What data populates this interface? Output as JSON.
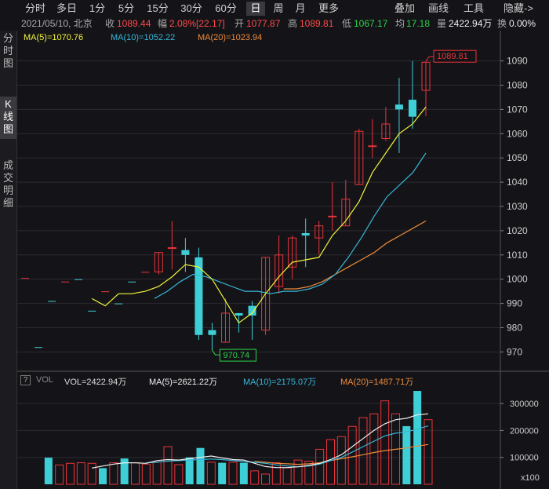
{
  "toolbar": {
    "period_tabs": [
      "分时",
      "多日",
      "1分",
      "5分",
      "15分",
      "30分",
      "60分",
      "日",
      "周",
      "月",
      "更多"
    ],
    "active_tab": "日",
    "right_tabs": [
      "叠加",
      "画线",
      "工具",
      "隐藏->"
    ]
  },
  "info": {
    "date": "2021/05/10, 北京",
    "close_label": "收",
    "close": "1089.44",
    "change_label": "幅",
    "change": "2.08%[22.17]",
    "open_label": "开",
    "open": "1077.87",
    "high_label": "高",
    "high": "1089.81",
    "low_label": "低",
    "low": "1067.17",
    "avg_label": "均",
    "avg": "17.18",
    "vol_label": "量",
    "vol": "2422.94万",
    "turnover_label": "换",
    "turnover": "0.00%"
  },
  "sidebar": [
    {
      "label": "分\n时\n图"
    },
    {
      "label": "K\n线\n图",
      "active": true
    },
    {
      "label": "成\n交\n明\n细"
    }
  ],
  "ma_legend": {
    "ma5": "MA(5)=1070.76",
    "ma10": "MA(10)=1052.22",
    "ma20": "MA(20)=1023.94"
  },
  "vol_legend": {
    "question": "?",
    "title": "VOL",
    "vol": "VOL=2422.94万",
    "ma5": "MA(5)=2621.22万",
    "ma10": "MA(10)=2175.07万",
    "ma20": "MA(20)=1487.71万"
  },
  "colors": {
    "up": "#e8333a",
    "down": "#3ecfd6",
    "ma5": "#f2f23a",
    "ma10": "#38b6d8",
    "ma20": "#ee8a3a",
    "grid": "#2a2a30"
  },
  "chart_data": [
    {
      "type": "candlestick",
      "y_ticks": [
        970,
        980,
        990,
        1000,
        1010,
        1020,
        1030,
        1040,
        1050,
        1060,
        1070,
        1080,
        1090
      ],
      "ylim": [
        963,
        1097
      ],
      "annotations": {
        "high": "1089.81",
        "low": "970.74"
      },
      "candles": [
        {
          "o": 1000.5,
          "h": 1000.5,
          "l": 1000.5,
          "c": 1000.5
        },
        {
          "o": 972,
          "h": 972,
          "l": 972,
          "c": 972
        },
        {
          "o": 991,
          "h": 991,
          "l": 991,
          "c": 991
        },
        {
          "o": 999,
          "h": 999,
          "l": 999,
          "c": 999
        },
        {
          "o": 1000,
          "h": 1000,
          "l": 1000,
          "c": 1000
        },
        {
          "o": 987,
          "h": 987,
          "l": 987,
          "c": 987
        },
        {
          "o": 995,
          "h": 995,
          "l": 995,
          "c": 995
        },
        {
          "o": 990,
          "h": 990,
          "l": 990,
          "c": 990
        },
        {
          "o": 999,
          "h": 999,
          "l": 999,
          "c": 999
        },
        {
          "o": 1003,
          "h": 1003,
          "l": 1003,
          "c": 1003
        },
        {
          "o": 1003,
          "h": 1011,
          "l": 1002,
          "c": 1011
        },
        {
          "o": 1013,
          "h": 1024,
          "l": 1004,
          "c": 1013
        },
        {
          "o": 1012,
          "h": 1017,
          "l": 1003,
          "c": 1010
        },
        {
          "o": 1009,
          "h": 1013,
          "l": 975,
          "c": 977
        },
        {
          "o": 979,
          "h": 982,
          "l": 970.74,
          "c": 977
        },
        {
          "o": 974,
          "h": 992,
          "l": 974,
          "c": 986
        },
        {
          "o": 986,
          "h": 986,
          "l": 978,
          "c": 985
        },
        {
          "o": 989,
          "h": 991,
          "l": 975,
          "c": 985
        },
        {
          "o": 979,
          "h": 1009,
          "l": 977,
          "c": 1009
        },
        {
          "o": 997,
          "h": 1018,
          "l": 994,
          "c": 1010
        },
        {
          "o": 1005,
          "h": 1018,
          "l": 1000,
          "c": 1017
        },
        {
          "o": 1019,
          "h": 1025,
          "l": 1005,
          "c": 1018
        },
        {
          "o": 1017,
          "h": 1024,
          "l": 1010,
          "c": 1022
        },
        {
          "o": 1026,
          "h": 1040,
          "l": 1020,
          "c": 1026
        },
        {
          "o": 1022,
          "h": 1041,
          "l": 1022,
          "c": 1033
        },
        {
          "o": 1039,
          "h": 1062,
          "l": 1039,
          "c": 1061
        },
        {
          "o": 1055,
          "h": 1066,
          "l": 1050,
          "c": 1055
        },
        {
          "o": 1058,
          "h": 1071,
          "l": 1057,
          "c": 1064
        },
        {
          "o": 1072,
          "h": 1083,
          "l": 1052,
          "c": 1070
        },
        {
          "o": 1074,
          "h": 1090,
          "l": 1062,
          "c": 1067
        },
        {
          "o": 1077.87,
          "h": 1089.81,
          "l": 1067.17,
          "c": 1089.44
        }
      ],
      "ma5": [
        null,
        null,
        null,
        null,
        null,
        992,
        989,
        994,
        994,
        995,
        997,
        1001,
        1006,
        1005,
        1000,
        991,
        982,
        986,
        994,
        1001,
        1007,
        1008,
        1009,
        1018,
        1024,
        1032,
        1044,
        1052,
        1060,
        1064,
        1071
      ],
      "ma10": [
        null,
        null,
        null,
        null,
        null,
        null,
        null,
        null,
        null,
        null,
        992,
        995,
        999,
        1002,
        1001,
        999,
        997,
        995,
        995,
        994,
        995,
        995,
        996,
        998,
        1002,
        1009,
        1017,
        1026,
        1034,
        1039,
        1044,
        1052
      ],
      "ma20": [
        null,
        null,
        null,
        null,
        null,
        null,
        null,
        null,
        null,
        null,
        null,
        null,
        null,
        null,
        null,
        null,
        null,
        null,
        null,
        null,
        996,
        996,
        997,
        999,
        1002,
        1005,
        1008,
        1011,
        1015,
        1018,
        1021,
        1024
      ]
    },
    {
      "type": "bar",
      "title": "VOL",
      "y_ticks": [
        100000,
        200000,
        300000
      ],
      "y_unit": "x100",
      "ylim": [
        0,
        350000
      ],
      "values": [
        0,
        99000,
        72000,
        78000,
        80000,
        78000,
        60000,
        80000,
        96000,
        80000,
        75000,
        83000,
        140000,
        73000,
        100000,
        135000,
        82000,
        80000,
        82000,
        80000,
        50000,
        38000,
        80000,
        61000,
        90000,
        86000,
        130000,
        166000,
        177000,
        215000,
        248000,
        262000,
        310000,
        262000,
        216000,
        347000,
        240000
      ],
      "directions": [
        "u",
        "d",
        "u",
        "u",
        "u",
        "u",
        "d",
        "u",
        "d",
        "u",
        "u",
        "u",
        "u",
        "u",
        "d",
        "d",
        "u",
        "d",
        "u",
        "d",
        "u",
        "u",
        "u",
        "u",
        "u",
        "u",
        "u",
        "u",
        "u",
        "u",
        "u",
        "u",
        "u",
        "u",
        "d",
        "d",
        "u"
      ],
      "ma5": [
        null,
        null,
        null,
        null,
        null,
        60000,
        68000,
        75000,
        80000,
        80000,
        78000,
        88000,
        92000,
        90000,
        95000,
        100000,
        105000,
        98000,
        92000,
        90000,
        78000,
        66000,
        62000,
        62000,
        65000,
        70000,
        78000,
        92000,
        110000,
        140000,
        170000,
        200000,
        225000,
        240000,
        245000,
        258000,
        262000
      ],
      "ma10": [
        null,
        null,
        null,
        null,
        null,
        null,
        null,
        null,
        null,
        null,
        80000,
        82000,
        86000,
        88000,
        90000,
        92000,
        94000,
        92000,
        88000,
        85000,
        82000,
        78000,
        72000,
        68000,
        65000,
        68000,
        75000,
        88000,
        100000,
        120000,
        140000,
        160000,
        180000,
        190000,
        195000,
        205000,
        217000
      ],
      "ma20": [
        null,
        null,
        null,
        null,
        null,
        null,
        null,
        null,
        null,
        null,
        null,
        null,
        null,
        null,
        null,
        null,
        null,
        null,
        null,
        null,
        85000,
        82000,
        78000,
        76000,
        74000,
        76000,
        80000,
        88000,
        95000,
        102000,
        110000,
        118000,
        125000,
        130000,
        135000,
        142000,
        148000
      ]
    }
  ]
}
